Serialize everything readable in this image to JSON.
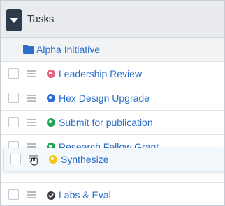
{
  "header": {
    "title": "Tasks",
    "toggle_icon": "caret-down-icon"
  },
  "group": {
    "label": "Alpha Initiative",
    "icon": "folder-icon",
    "color": "#2a6fc9"
  },
  "tasks": [
    {
      "label": "Leadership Review",
      "status_color": "#e8617e"
    },
    {
      "label": "Hex Design Upgrade",
      "status_color": "#2c6fd6"
    },
    {
      "label": "Submit for publication",
      "status_color": "#22a35a"
    },
    {
      "label": "Research Fellow Grant",
      "status_color": "#22a35a"
    },
    {
      "label": "Labs & Eval",
      "status_color": "#3d4147"
    }
  ],
  "dragged_task": {
    "label": "Synthesize",
    "status_color": "#f5c518",
    "cursor_icon": "grab-hand-icon"
  }
}
